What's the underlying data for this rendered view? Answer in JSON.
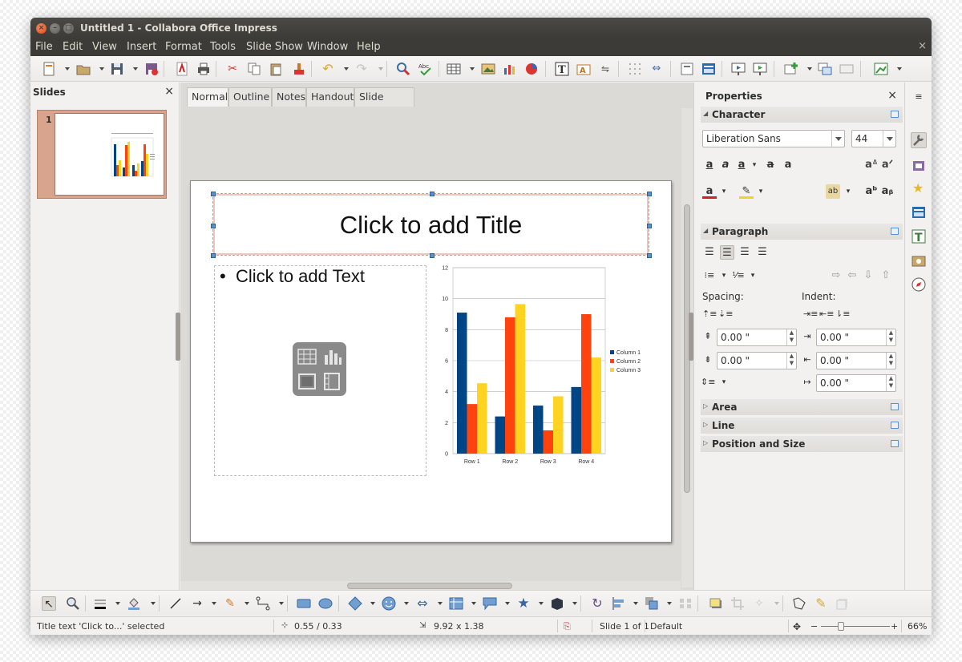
{
  "window": {
    "title": "Untitled 1 - Collabora Office Impress"
  },
  "menu": [
    "File",
    "Edit",
    "View",
    "Insert",
    "Format",
    "Tools",
    "Slide Show",
    "Window",
    "Help"
  ],
  "slides_panel": {
    "title": "Slides",
    "close": "×",
    "slide_number": "1"
  },
  "view_tabs": [
    "Normal",
    "Outline",
    "Notes",
    "Handout",
    "Slide Sorter"
  ],
  "slide": {
    "title_placeholder": "Click to add Title",
    "text_placeholder": "Click to add Text",
    "bullet": "•"
  },
  "chart_data": {
    "type": "bar",
    "categories": [
      "Row 1",
      "Row 2",
      "Row 3",
      "Row 4"
    ],
    "series": [
      {
        "name": "Column 1",
        "values": [
          9.1,
          2.4,
          3.1,
          4.3
        ],
        "color": "#004586"
      },
      {
        "name": "Column 2",
        "values": [
          3.2,
          8.8,
          1.5,
          9.0
        ],
        "color": "#ff420e"
      },
      {
        "name": "Column 3",
        "values": [
          4.54,
          9.65,
          3.7,
          6.2
        ],
        "color": "#ffd320"
      }
    ],
    "ylim": [
      0,
      12
    ],
    "yticks": [
      "0",
      "2",
      "4",
      "6",
      "8",
      "10",
      "12"
    ],
    "grid": true,
    "legend": "right"
  },
  "properties": {
    "title": "Properties",
    "close": "×",
    "character": {
      "label": "Character",
      "font": "Liberation Sans",
      "size": "44"
    },
    "paragraph": {
      "label": "Paragraph",
      "spacing_label": "Spacing:",
      "indent_label": "Indent:",
      "above": "0.00 \"",
      "below": "0.00 \"",
      "before_text": "0.00 \"",
      "after_text": "0.00 \"",
      "first_line": "0.00 \""
    },
    "area": "Area",
    "line": "Line",
    "position_size": "Position and Size"
  },
  "status": {
    "selection": "Title text 'Click to...' selected",
    "position": "0.55 / 0.33",
    "size": "9.92 x 1.38",
    "slide": "Slide 1 of 1",
    "layout": "Default",
    "zoom": "66%"
  },
  "colors": {
    "titlebar": "#3c3b37",
    "close_button": "#df4a16",
    "selection_handle": "#5d8fc9"
  }
}
